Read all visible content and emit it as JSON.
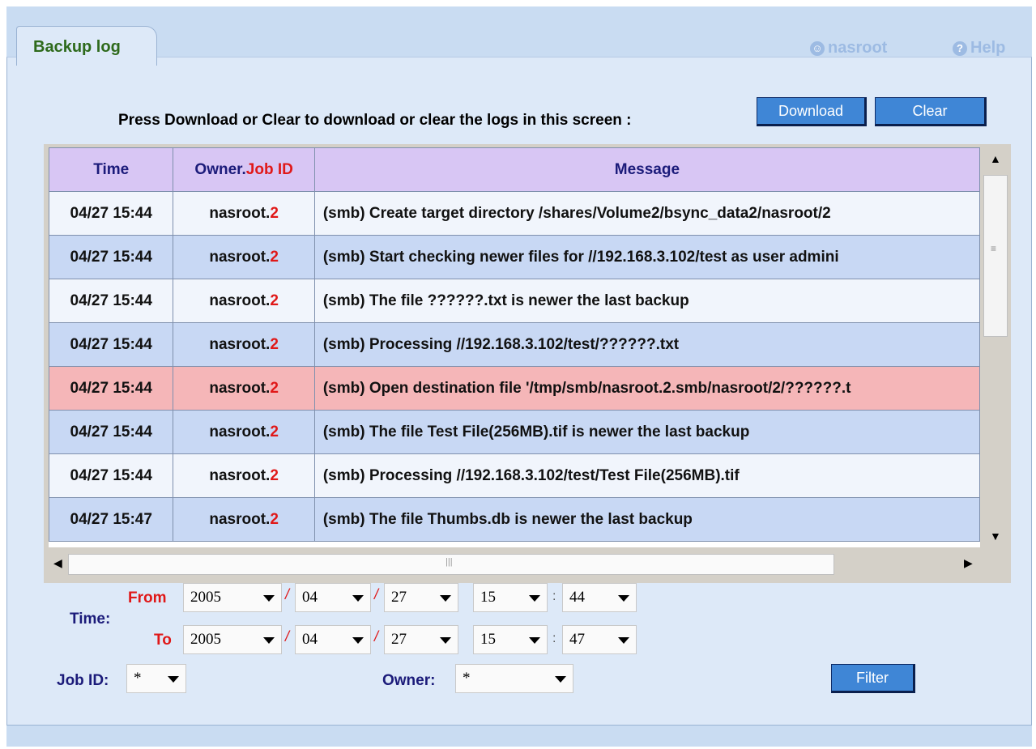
{
  "tab": {
    "label": "Backup log"
  },
  "user": {
    "name": "nasroot"
  },
  "help": {
    "label": "Help"
  },
  "prompt": "Press Download or Clear to download or clear the logs in this screen :",
  "buttons": {
    "download": "Download",
    "clear": "Clear",
    "filter": "Filter"
  },
  "table": {
    "headers": {
      "time": "Time",
      "owner": "Owner.",
      "jobid": "Job ID",
      "message": "Message"
    },
    "rows": [
      {
        "time": "04/27 15:44",
        "owner": "nasroot.",
        "jobid": "2",
        "message": "(smb) Create target directory /shares/Volume2/bsync_data2/nasroot/2",
        "status": "normal"
      },
      {
        "time": "04/27 15:44",
        "owner": "nasroot.",
        "jobid": "2",
        "message": "(smb) Start checking newer files for //192.168.3.102/test as user admini",
        "status": "normal"
      },
      {
        "time": "04/27 15:44",
        "owner": "nasroot.",
        "jobid": "2",
        "message": "(smb) The file ??????.txt is newer the last backup",
        "status": "normal"
      },
      {
        "time": "04/27 15:44",
        "owner": "nasroot.",
        "jobid": "2",
        "message": "(smb) Processing //192.168.3.102/test/??????.txt",
        "status": "normal"
      },
      {
        "time": "04/27 15:44",
        "owner": "nasroot.",
        "jobid": "2",
        "message": "(smb) Open destination file '/tmp/smb/nasroot.2.smb/nasroot/2/??????.t",
        "status": "error"
      },
      {
        "time": "04/27 15:44",
        "owner": "nasroot.",
        "jobid": "2",
        "message": "(smb) The file Test File(256MB).tif is newer the last backup",
        "status": "normal"
      },
      {
        "time": "04/27 15:44",
        "owner": "nasroot.",
        "jobid": "2",
        "message": "(smb) Processing //192.168.3.102/test/Test File(256MB).tif",
        "status": "normal"
      },
      {
        "time": "04/27 15:47",
        "owner": "nasroot.",
        "jobid": "2",
        "message": "(smb) The file Thumbs.db is newer the last backup",
        "status": "normal"
      }
    ]
  },
  "filter": {
    "time_label": "Time:",
    "from_label": "From",
    "to_label": "To",
    "from": {
      "year": "2005",
      "month": "04",
      "day": "27",
      "hour": "15",
      "minute": "44"
    },
    "to": {
      "year": "2005",
      "month": "04",
      "day": "27",
      "hour": "15",
      "minute": "47"
    },
    "sep_date": "/",
    "sep_time": ":",
    "jobid_label": "Job ID:",
    "jobid_value": "*",
    "owner_label": "Owner:",
    "owner_value": "*"
  },
  "colors": {
    "accent": "#3f86d6",
    "error_row": "#f5b6b8",
    "header_bg": "#d8c6f4",
    "tab_text": "#2e6a1c"
  }
}
